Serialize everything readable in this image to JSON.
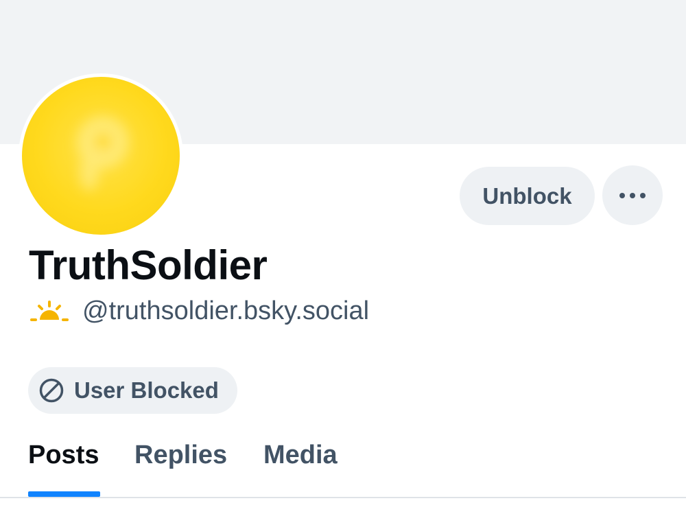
{
  "profile": {
    "display_name": "TruthSoldier",
    "handle": "@truthsoldier.bsky.social",
    "avatar_color": "#ffd91d",
    "handle_emoji_icon": "sunrise-icon"
  },
  "actions": {
    "unblock_label": "Unblock",
    "more_icon": "ellipsis-icon"
  },
  "status": {
    "blocked_label": "User Blocked",
    "blocked_icon": "block-icon"
  },
  "tabs": [
    {
      "label": "Posts",
      "active": true
    },
    {
      "label": "Replies",
      "active": false
    },
    {
      "label": "Media",
      "active": false
    }
  ],
  "colors": {
    "accent": "#1083fe",
    "muted_text": "#425365",
    "banner": "#f1f3f5"
  }
}
